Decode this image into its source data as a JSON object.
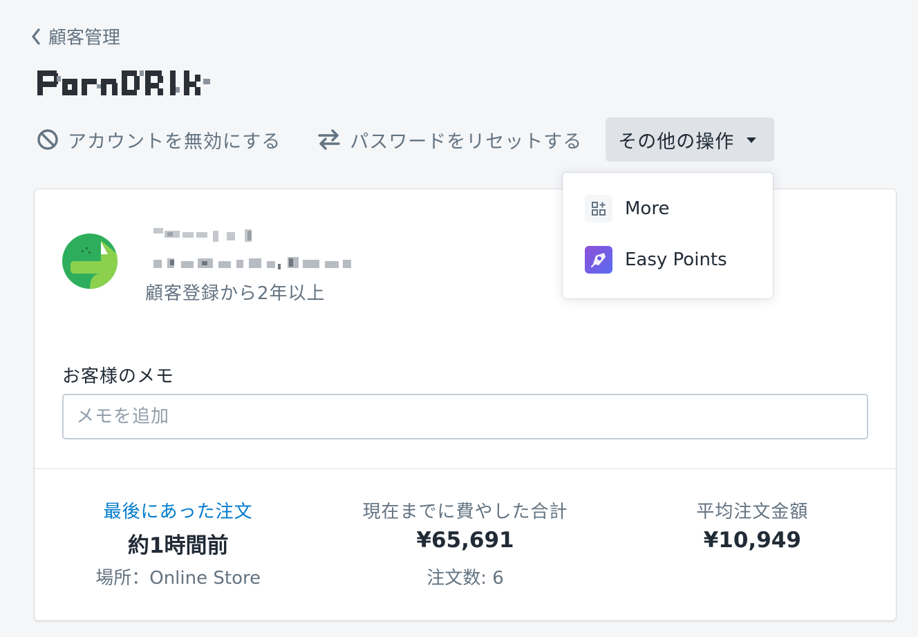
{
  "breadcrumb": {
    "label": "顧客管理"
  },
  "actions": {
    "disable_account": "アカウントを無効にする",
    "reset_password": "パスワードをリセットする",
    "more_actions": "その他の操作"
  },
  "dropdown": {
    "items": [
      {
        "label": "More",
        "icon": "apps-grid-icon"
      },
      {
        "label": "Easy Points",
        "icon": "easy-points-app-icon"
      }
    ]
  },
  "customer": {
    "tenure": "顧客登録から2年以上"
  },
  "note": {
    "label": "お客様のメモ",
    "placeholder": "メモを追加"
  },
  "stats": [
    {
      "label": "最後にあった注文",
      "value": "約1時間前",
      "sub": "場所：Online Store"
    },
    {
      "label": "現在までに費やした合計",
      "value": "¥65,691",
      "sub": "注文数: 6"
    },
    {
      "label": "平均注文金額",
      "value": "¥10,949",
      "sub": ""
    }
  ],
  "colors": {
    "link": "#007ace",
    "muted": "#637381",
    "avatar_dark": "#2eae5c",
    "avatar_light": "#8bd14e"
  }
}
